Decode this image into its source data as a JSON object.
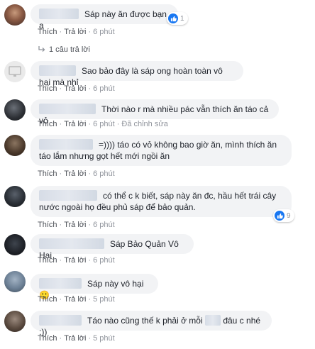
{
  "actions": {
    "like": "Thích",
    "reply": "Trả lời",
    "sep": "·",
    "edited": "Đã chỉnh sửa"
  },
  "colors": {
    "accent": "#1877f2",
    "bubble": "#f2f3f5",
    "meta": "#90949c"
  },
  "comments": [
    {
      "text": "Sáp này ăn được bạn ạ",
      "time": "6 phút",
      "reactions": "1"
    },
    {
      "replies": "1 câu trả lời"
    },
    {
      "text": "Sao bảo đây là sáp ong hoàn toàn vô hại mà nhỉ",
      "time": "6 phút"
    },
    {
      "text": "Thời nào r mà nhiều pác vẫn thích ăn táo cả vỏ",
      "time": "6 phút"
    },
    {
      "line1": "=)))) táo có vỏ không bao giờ ăn, mình thích ăn",
      "line2": "táo lắm nhưng gọt hết mới ngồi ăn",
      "time": "6 phút"
    },
    {
      "line1": "có thể c k biết, sáp này ăn đc, hầu hết trái cây",
      "line2": "nước ngoài họ đều phủ sáp để bảo quản.",
      "time": "6 phút",
      "reactions": "9"
    },
    {
      "text": "Sáp Bảo Quản Vô Hại",
      "time": "6 phút"
    },
    {
      "text": "Sáp này vô hại",
      "emoji": "🙂",
      "time": "5 phút"
    },
    {
      "text_a": "Táo nào cũng thế k phải ở mỗi",
      "text_b": "đâu c nhé :))",
      "time": "5 phút"
    }
  ]
}
